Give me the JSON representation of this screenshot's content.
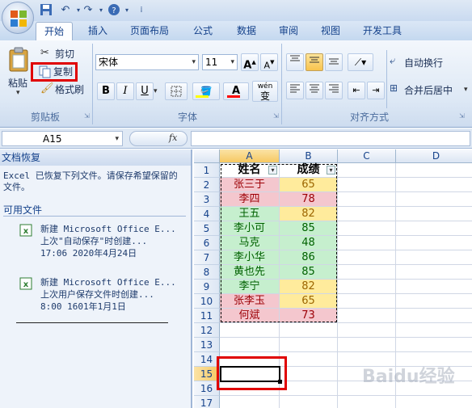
{
  "tabs": [
    "开始",
    "插入",
    "页面布局",
    "公式",
    "数据",
    "审阅",
    "视图",
    "开发工具"
  ],
  "clipboard": {
    "paste": "粘贴",
    "cut": "剪切",
    "copy": "复制",
    "format_painter": "格式刷",
    "label": "剪贴板"
  },
  "font": {
    "name": "宋体",
    "size": "11",
    "label": "字体",
    "bold": "B",
    "italic": "I",
    "underline": "U",
    "grow": "A",
    "shrink": "A",
    "font_color": "A",
    "phonetic": "wén",
    "phonetic2": "变"
  },
  "alignment": {
    "wrap": "自动换行",
    "merge": "合并后居中",
    "label": "对齐方式"
  },
  "formula_bar": {
    "name_box": "A15",
    "fx": "fx",
    "formula": ""
  },
  "task_pane": {
    "title": "文档恢复",
    "message": "Excel 已恢复下列文件。请保存希望保留的文件。",
    "section": "可用文件",
    "files": [
      {
        "name": "新建 Microsoft Office E...",
        "desc": "上次\"自动保存\"时创建...",
        "time": "17:06 2020年4月24日"
      },
      {
        "name": "新建 Microsoft Office E...",
        "desc": "上次用户保存文件时创建...",
        "time": "8:00 1601年1月1日"
      }
    ]
  },
  "sheet": {
    "columns": [
      "A",
      "B",
      "C",
      "D"
    ],
    "rows": [
      "1",
      "2",
      "3",
      "4",
      "5",
      "6",
      "7",
      "8",
      "9",
      "10",
      "11",
      "12",
      "13",
      "14",
      "15",
      "16",
      "17"
    ],
    "headers": [
      "姓名",
      "成绩"
    ],
    "data": [
      [
        "张三于",
        "65"
      ],
      [
        "李四",
        "78"
      ],
      [
        "王五",
        "82"
      ],
      [
        "李小可",
        "85"
      ],
      [
        "马克",
        "48"
      ],
      [
        "李小华",
        "86"
      ],
      [
        "黄也先",
        "85"
      ],
      [
        "李宁",
        "82"
      ],
      [
        "张李玉",
        "65"
      ],
      [
        "何斌",
        "73"
      ]
    ],
    "name_colors": [
      "#f4c7ce",
      "#f4c7ce",
      "#c6efce",
      "#c6efce",
      "#c6efce",
      "#c6efce",
      "#c6efce",
      "#c6efce",
      "#f4c7ce",
      "#f4c7ce"
    ],
    "name_text": [
      "#9c0006",
      "#9c0006",
      "#006100",
      "#006100",
      "#006100",
      "#006100",
      "#006100",
      "#006100",
      "#9c0006",
      "#9c0006"
    ],
    "score_colors": [
      "#ffeb9c",
      "#f4c7ce",
      "#ffeb9c",
      "#c6efce",
      "#c6efce",
      "#c6efce",
      "#c6efce",
      "#ffeb9c",
      "#ffeb9c",
      "#f4c7ce"
    ],
    "score_text": [
      "#9c6500",
      "#9c0006",
      "#9c6500",
      "#006100",
      "#006100",
      "#006100",
      "#006100",
      "#9c6500",
      "#9c6500",
      "#9c0006"
    ],
    "active_cell": "A15"
  },
  "watermark": "Baidu经验"
}
